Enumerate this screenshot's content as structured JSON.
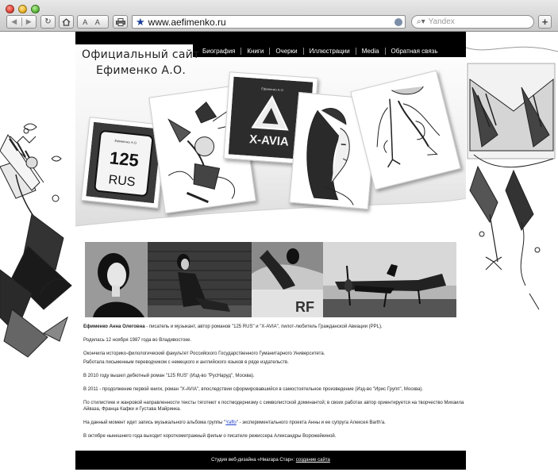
{
  "browser": {
    "url": "www.aefimenko.ru",
    "search_placeholder": "Yandex",
    "font_size_label": "A A",
    "new_tab_label": "+"
  },
  "site": {
    "title_line1": "Официальный сайт",
    "title_line2": "Ефименко А.О.",
    "menu": [
      "Биография",
      "Книги",
      "Очерки",
      "Иллюстрации",
      "Media",
      "Обратная связь"
    ],
    "book_plate": {
      "number": "125",
      "region": "RUS",
      "author_small": "Ефименко А.О."
    },
    "book_xavia": {
      "title": "X-AVIA",
      "author_small": "Ефименко А.О."
    }
  },
  "bio": {
    "name": "Ефименко Анна Олеговна",
    "intro": " - писатель и музыкант, автор романов \"125 RUS\" и \"X-AVIA\", пилот-любитель Гражданской Авиации (PPL).",
    "p2": "Родилась 12 ноября 1987 года во Владивостоке.",
    "p3": "Окончила историко-филологический факультет Российского Государственного Гуманитарного Университета.",
    "p4": "Работала письменным переводчиком с немецкого и английского языков в ряде издательств.",
    "p5": "В 2010 году вышел дебютный роман \"125 RUS\" (Изд-во \"РусНаруд\", Москва).",
    "p6": "В 2011 - продолжение первой книги, роман \"X-AVIA\", впоследствии сформировавшийся в самостоятельное произведение (Изд-во \"Ирис Групп\", Москва).",
    "p7": "По стилистике и жанровой направленности тексты тяготеют к постмодернизму с символистской доминантой; в своих работах автор ориентируется на творчество Михаила Айваза, Франца Кафки и Густава Майринка.",
    "p8_before": "На данный момент идет запись музыкального альбома группы \"",
    "p8_link": "Yaffo",
    "p8_after": "\" - экспериментального проекта Анны и ее супруга Алексея Barth'a.",
    "p9": "В октябре нынешнего года выходит короткометражный фильм о писателе режиссера Александры Ворожейкиной."
  },
  "footer": {
    "text": "Студия веб-дизайна «Ниагара Стар»: ",
    "link": "создание сайта"
  },
  "colors": {
    "nav_bg": "#000000",
    "link": "#2244cc",
    "url_star": "#1d3f9a"
  }
}
